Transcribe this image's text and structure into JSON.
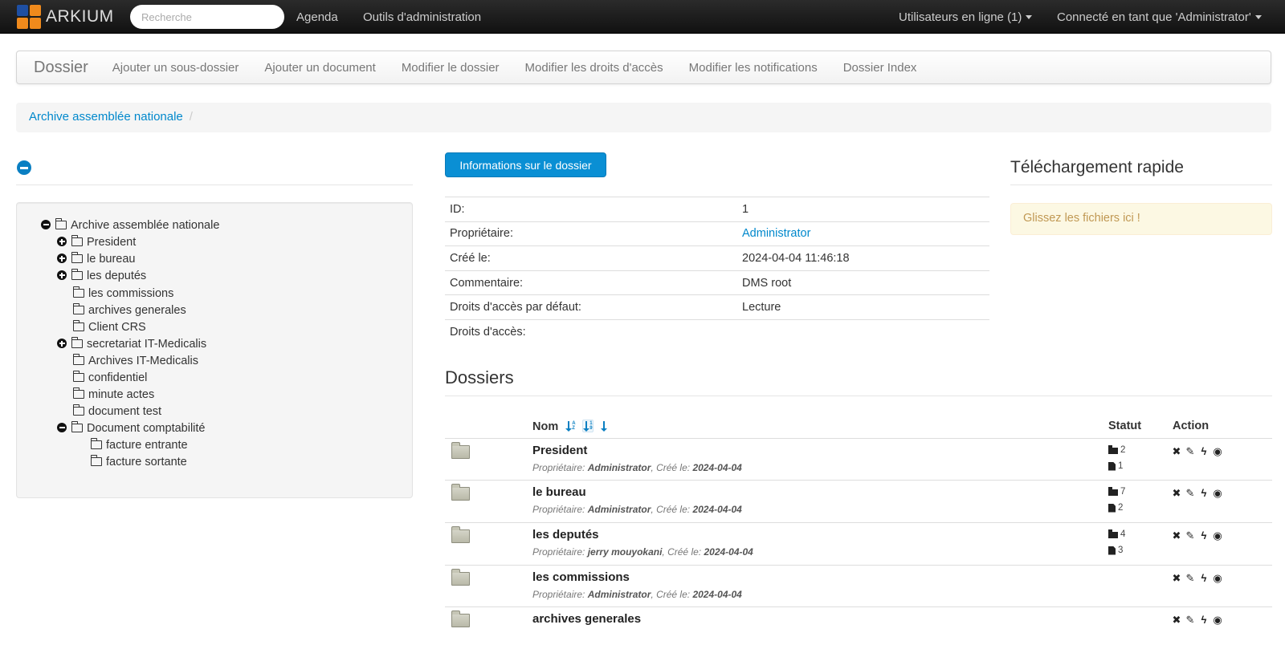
{
  "brand": {
    "name": "ARKIUM",
    "logo_colors": [
      "#1e4fa3",
      "#f08a1c",
      "#f08a1c",
      "#f08a1c"
    ]
  },
  "search": {
    "placeholder": "Recherche"
  },
  "topnav": {
    "items": [
      "Agenda",
      "Outils d'administration"
    ],
    "online_users": "Utilisateurs en ligne (1)",
    "connected_as": "Connecté en tant que 'Administrator'"
  },
  "subnav": {
    "title": "Dossier",
    "links": [
      "Ajouter un sous-dossier",
      "Ajouter un document",
      "Modifier le dossier",
      "Modifier les droits d'accès",
      "Modifier les notifications",
      "Dossier Index"
    ]
  },
  "breadcrumb": {
    "root": "Archive assemblée nationale",
    "separator": "/"
  },
  "tree": {
    "root": "Archive assemblée nationale",
    "children": [
      "President",
      "le bureau",
      "les deputés",
      "les commissions",
      "archives generales",
      "Client CRS",
      "secretariat IT-Medicalis",
      "Archives IT-Medicalis",
      "confidentiel",
      "minute actes",
      "document test",
      "Document comptabilité"
    ],
    "grandchildren": [
      "facture entrante",
      "facture sortante"
    ]
  },
  "info": {
    "button_label": "Informations sur le dossier",
    "rows": [
      {
        "label": "ID:",
        "value": "1"
      },
      {
        "label": "Propriétaire:",
        "value": "Administrator"
      },
      {
        "label": "Créé le:",
        "value": "2024-04-04 11:46:18"
      },
      {
        "label": "Commentaire:",
        "value": "DMS root"
      },
      {
        "label": "Droits d'accès par défaut:",
        "value": "Lecture"
      },
      {
        "label": "Droits d'accès:",
        "value": ""
      }
    ]
  },
  "dossiers": {
    "heading": "Dossiers",
    "columns": {
      "name": "Nom",
      "status": "Statut",
      "action": "Action"
    },
    "owner_label": "Propriétaire:",
    "created_label": "Créé le:",
    "rows": [
      {
        "name": "President",
        "owner": "Administrator",
        "created": "2024-04-04",
        "folders": "2",
        "docs": "1"
      },
      {
        "name": "le bureau",
        "owner": "Administrator",
        "created": "2024-04-04",
        "folders": "7",
        "docs": "2"
      },
      {
        "name": "les deputés",
        "owner": "jerry mouyokani",
        "created": "2024-04-04",
        "folders": "4",
        "docs": "3"
      },
      {
        "name": "les commissions",
        "owner": "Administrator",
        "created": "2024-04-04",
        "folders": "",
        "docs": ""
      },
      {
        "name": "archives generales",
        "owner": "",
        "created": "",
        "folders": "",
        "docs": ""
      }
    ],
    "action_icons": [
      "delete-icon",
      "edit-icon",
      "bolt-icon",
      "eye-icon"
    ]
  },
  "quick_upload": {
    "heading": "Téléchargement rapide",
    "dropzone": "Glissez les fichiers ici !"
  },
  "colors": {
    "link": "#0088cc",
    "primary_button": "#0a8fd4",
    "dropzone_bg": "#fcf8e3",
    "dropzone_text": "#c09853"
  }
}
